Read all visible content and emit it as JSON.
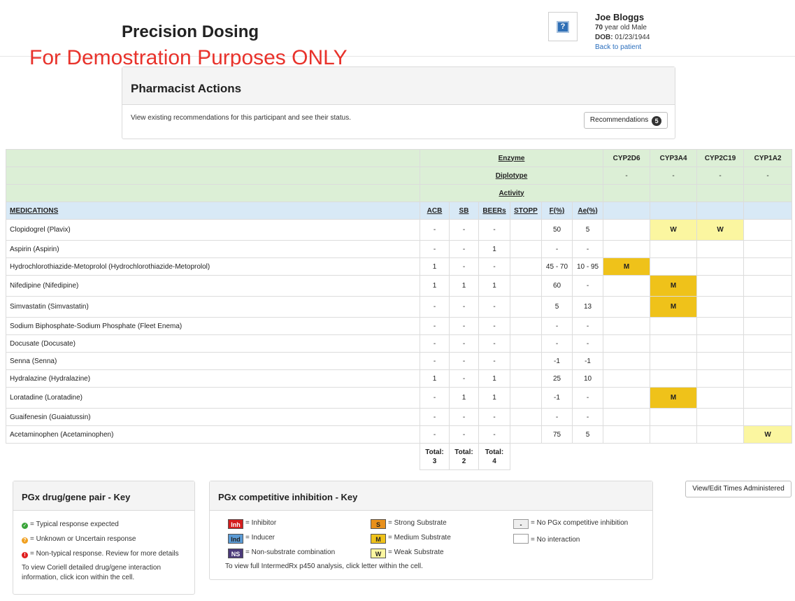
{
  "header": {
    "title": "Precision Dosing",
    "demo_notice": "For Demostration Purposes ONLY",
    "photo_icon": "?",
    "patient": {
      "name": "Joe Bloggs",
      "age": "70",
      "age_rest": "year old Male",
      "dob_label": "DOB:",
      "dob": "01/23/1944",
      "back_link": "Back to patient"
    }
  },
  "pharmacist_actions": {
    "title": "Pharmacist Actions",
    "description": "View existing recommendations for this participant and see their status.",
    "button_label": "Recommendations",
    "badge_count": "5"
  },
  "table": {
    "header_rows": {
      "enzyme": "Enzyme",
      "diplotype": "Diplotype",
      "activity": "Activity"
    },
    "enzymes": [
      {
        "name": "CYP2D6",
        "diplotype": "-"
      },
      {
        "name": "CYP3A4",
        "diplotype": "-"
      },
      {
        "name": "CYP2C19",
        "diplotype": "-"
      },
      {
        "name": "CYP1A2",
        "diplotype": "-"
      }
    ],
    "columns": {
      "medications": "MEDICATIONS",
      "acb": "ACB",
      "sb": "SB",
      "beers": "BEERs",
      "stopp": "STOPP",
      "f": "F(%)",
      "ae": "Ae(%)"
    },
    "rows": [
      {
        "name": "Clopidogrel (Plavix)",
        "acb": "-",
        "sb": "-",
        "beers": "-",
        "stopp": "",
        "f": "50",
        "ae": "5",
        "cyp": [
          "",
          "W",
          "W",
          ""
        ]
      },
      {
        "name": "Aspirin (Aspirin)",
        "acb": "-",
        "sb": "-",
        "beers": "1",
        "stopp": "",
        "f": "-",
        "ae": "-",
        "cyp": [
          "",
          "",
          "",
          ""
        ]
      },
      {
        "name": "Hydrochlorothiazide-Metoprolol (Hydrochlorothiazide-Metoprolol)",
        "acb": "1",
        "sb": "-",
        "beers": "-",
        "stopp": "",
        "f": "45 - 70",
        "ae": "10 - 95",
        "cyp": [
          "M",
          "",
          "",
          ""
        ]
      },
      {
        "name": "Nifedipine (Nifedipine)",
        "acb": "1",
        "sb": "1",
        "beers": "1",
        "stopp": "",
        "f": "60",
        "ae": "-",
        "cyp": [
          "",
          "M",
          "",
          ""
        ]
      },
      {
        "name": "Simvastatin (Simvastatin)",
        "acb": "-",
        "sb": "-",
        "beers": "-",
        "stopp": "",
        "f": "5",
        "ae": "13",
        "cyp": [
          "",
          "M",
          "",
          ""
        ]
      },
      {
        "name": "Sodium Biphosphate-Sodium Phosphate (Fleet Enema)",
        "acb": "-",
        "sb": "-",
        "beers": "-",
        "stopp": "",
        "f": "-",
        "ae": "-",
        "cyp": [
          "",
          "",
          "",
          ""
        ]
      },
      {
        "name": "Docusate (Docusate)",
        "acb": "-",
        "sb": "-",
        "beers": "-",
        "stopp": "",
        "f": "-",
        "ae": "-",
        "cyp": [
          "",
          "",
          "",
          ""
        ]
      },
      {
        "name": "Senna (Senna)",
        "acb": "-",
        "sb": "-",
        "beers": "-",
        "stopp": "",
        "f": "-1",
        "ae": "-1",
        "cyp": [
          "",
          "",
          "",
          ""
        ]
      },
      {
        "name": "Hydralazine (Hydralazine)",
        "acb": "1",
        "sb": "-",
        "beers": "1",
        "stopp": "",
        "f": "25",
        "ae": "10",
        "cyp": [
          "",
          "",
          "",
          ""
        ]
      },
      {
        "name": "Loratadine (Loratadine)",
        "acb": "-",
        "sb": "1",
        "beers": "1",
        "stopp": "",
        "f": "-1",
        "ae": "-",
        "cyp": [
          "",
          "M",
          "",
          ""
        ]
      },
      {
        "name": "Guaifenesin (Guaiatussin)",
        "acb": "-",
        "sb": "-",
        "beers": "-",
        "stopp": "",
        "f": "-",
        "ae": "-",
        "cyp": [
          "",
          "",
          "",
          ""
        ]
      },
      {
        "name": "Acetaminophen (Acetaminophen)",
        "acb": "-",
        "sb": "-",
        "beers": "-",
        "stopp": "",
        "f": "75",
        "ae": "5",
        "cyp": [
          "",
          "",
          "",
          "W"
        ]
      }
    ],
    "totals": {
      "label": "Total:",
      "acb": "3",
      "sb": "2",
      "beers": "4"
    }
  },
  "key_gene": {
    "title": "PGx drug/gene pair - Key",
    "items": [
      {
        "icon": "check-circle-icon",
        "glyph": "✓",
        "color": "#3aa53a",
        "text": "= Typical response expected"
      },
      {
        "icon": "question-circle-icon",
        "glyph": "?",
        "color": "#f0a020",
        "text": "= Unknown or Uncertain response"
      },
      {
        "icon": "exclamation-circle-icon",
        "glyph": "!",
        "color": "#e02020",
        "text": "= Non-typical response. Review for more details"
      }
    ],
    "note": "To view Coriell detailed drug/gene interaction information, click icon within the cell."
  },
  "key_inhibition": {
    "title": "PGx competitive inhibition - Key",
    "items": [
      {
        "code": "Inh",
        "bg": "#d41e1e",
        "fg": "#ffffff",
        "text": "= Inhibitor"
      },
      {
        "code": "Ind",
        "bg": "#5b9bd5",
        "fg": "#222222",
        "text": "= Inducer"
      },
      {
        "code": "NS",
        "bg": "#4b3a7a",
        "fg": "#ffffff",
        "text": "= Non-substrate combination"
      },
      {
        "code": "S",
        "bg": "#e8901c",
        "fg": "#222222",
        "text": "= Strong Substrate"
      },
      {
        "code": "M",
        "bg": "#efc21a",
        "fg": "#222222",
        "text": "= Medium Substrate"
      },
      {
        "code": "W",
        "bg": "#fbf6a0",
        "fg": "#222222",
        "text": "= Weak Substrate"
      },
      {
        "code": "-",
        "bg": "#eeeeee",
        "fg": "#222222",
        "text": "= No PGx competitive inhibition"
      },
      {
        "code": "",
        "bg": "#ffffff",
        "fg": "#222222",
        "text": "= No interaction"
      }
    ],
    "note": "To view full IntermedRx p450 analysis, click letter within the cell."
  },
  "view_times_button": "View/Edit Times Administered",
  "colors": {
    "weak": "#fbf6a0",
    "medium": "#efc21a",
    "green_header": "#dcefd6",
    "blue_header": "#d8e9f6",
    "demo_red": "#e8322b"
  }
}
